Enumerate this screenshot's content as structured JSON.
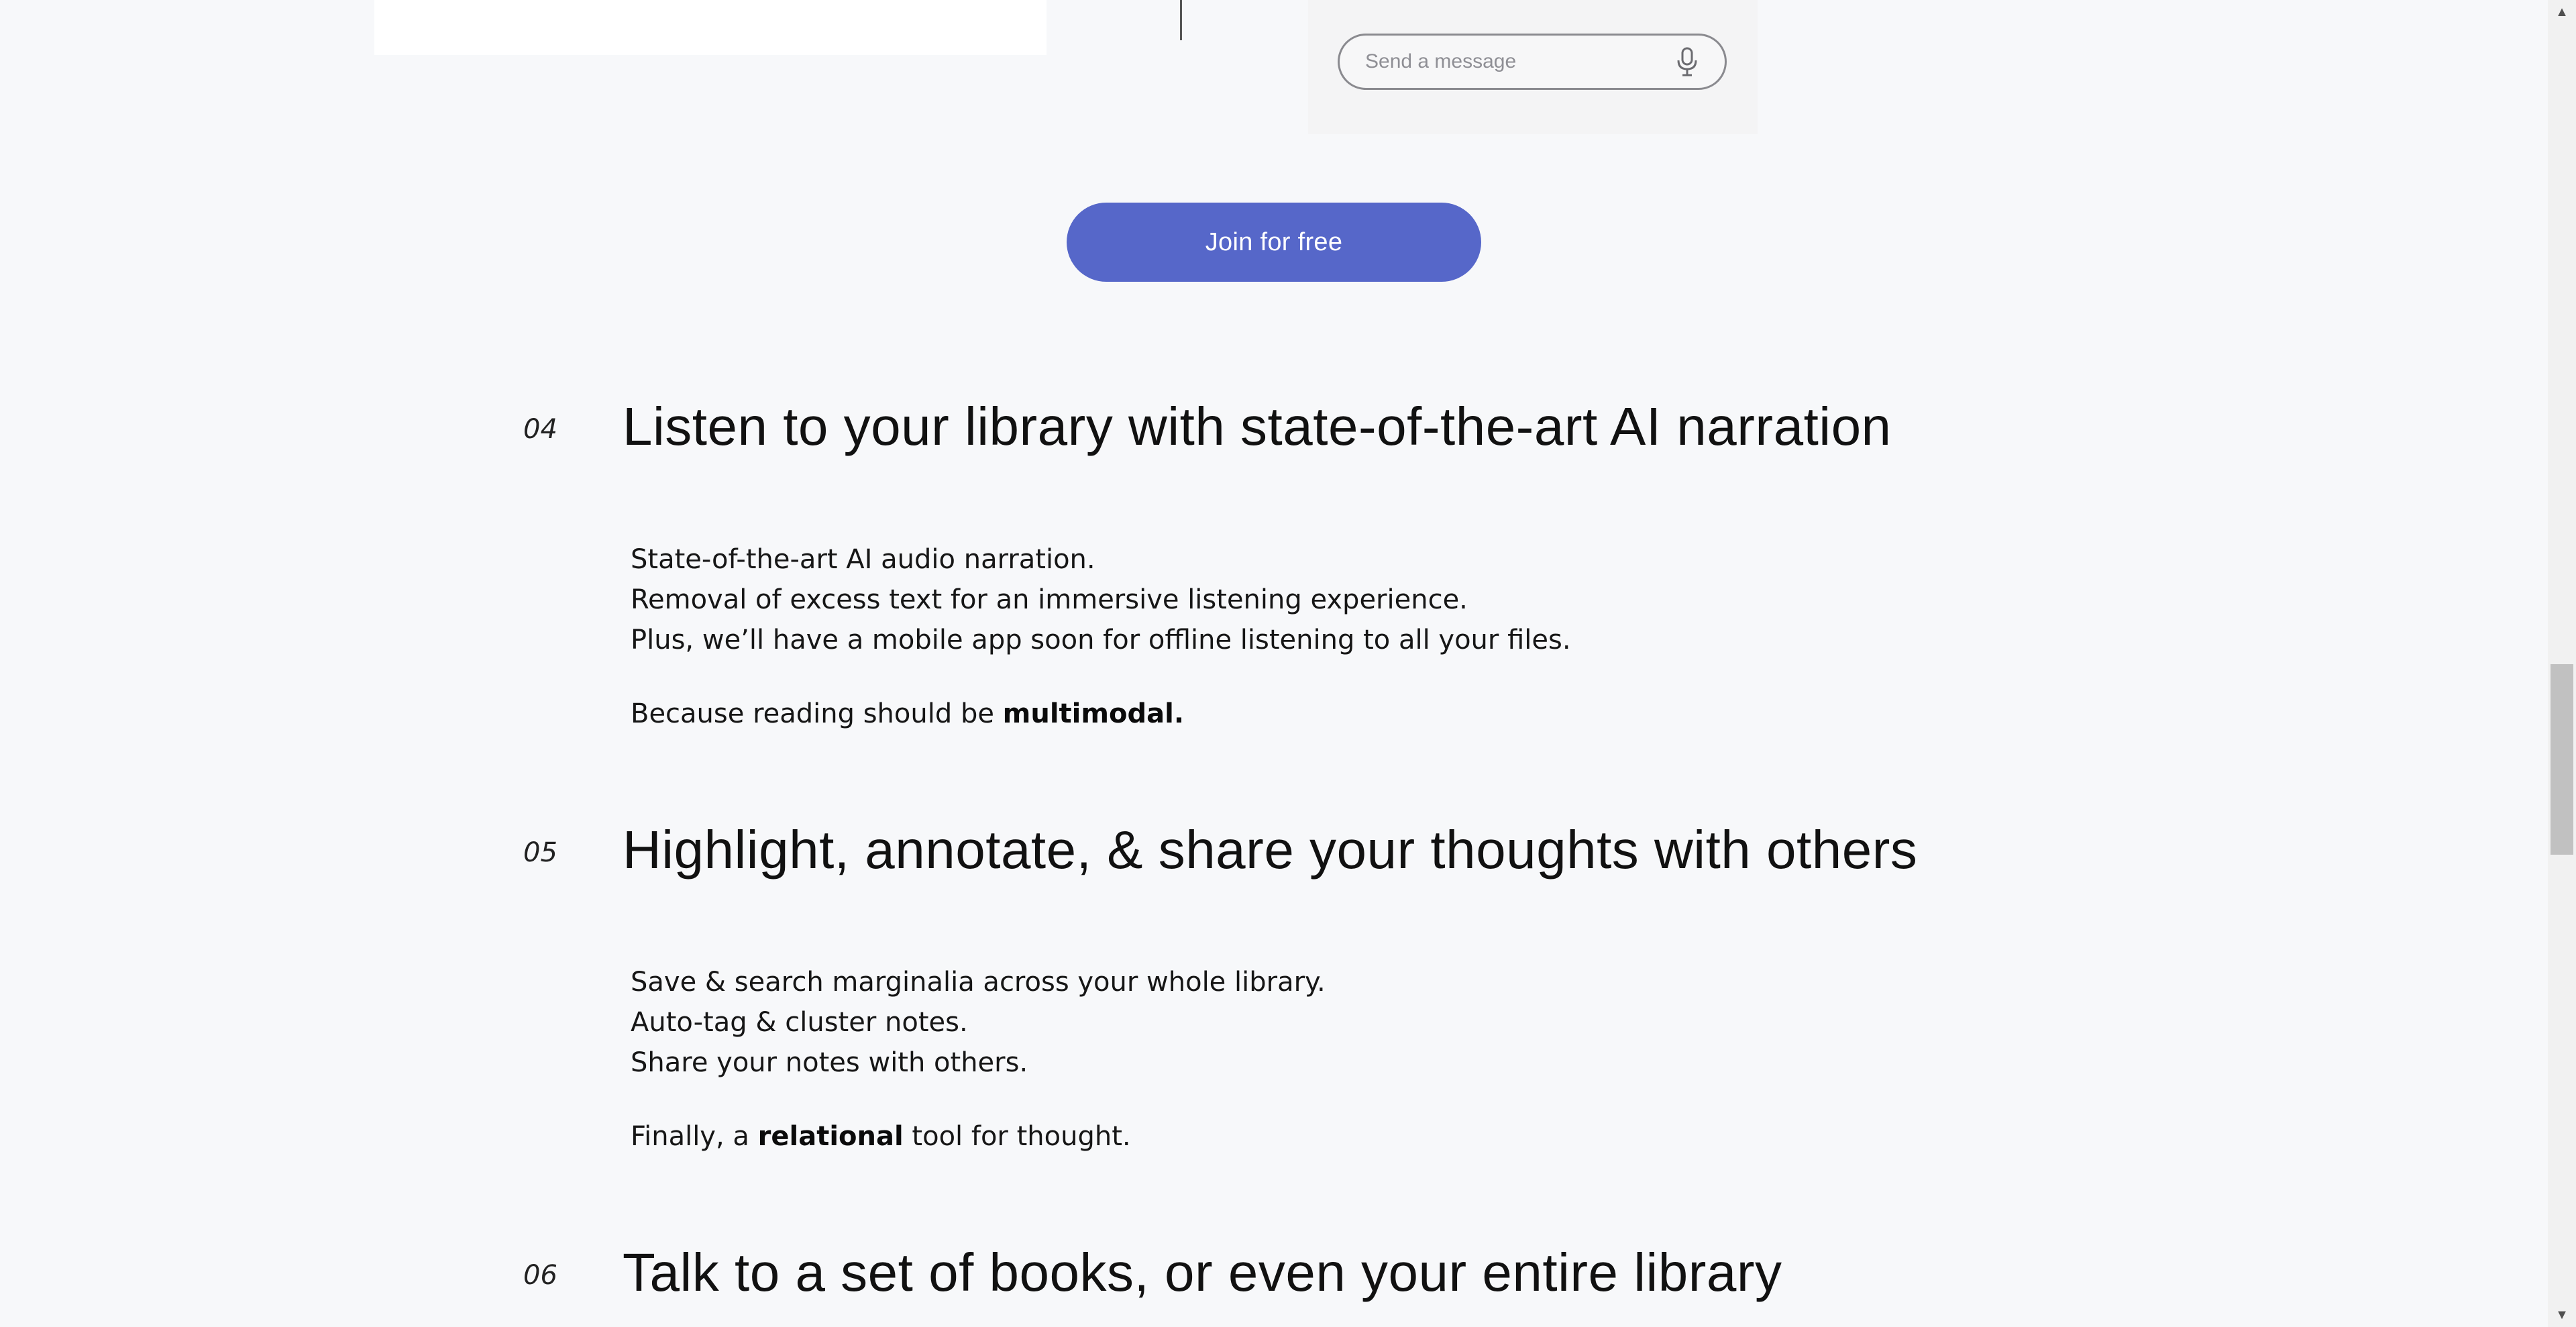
{
  "chat": {
    "placeholder": "Send a message",
    "mic_icon": "microphone-icon"
  },
  "cta": {
    "join_label": "Join for free",
    "color": "#5667c9"
  },
  "features": [
    {
      "number": "04",
      "title": "Listen to your library with state-of-the-art AI narration",
      "lines": [
        "State-of-the-art AI audio narration.",
        "Removal of excess text for an immersive listening experience.",
        "Plus, we’ll have a mobile app soon for offline listening to all your files."
      ],
      "tagline_prefix": "Because reading should be ",
      "tagline_bold": "multimodal.",
      "tagline_suffix": ""
    },
    {
      "number": "05",
      "title": "Highlight, annotate, & share your thoughts with others",
      "lines": [
        "Save & search marginalia across your whole library.",
        "Auto-tag & cluster notes.",
        "Share your notes with others."
      ],
      "tagline_prefix": "Finally, a ",
      "tagline_bold": "relational",
      "tagline_suffix": " tool for thought."
    },
    {
      "number": "06",
      "title": "Talk to a set of books, or even your entire library"
    }
  ],
  "scrollbar": {
    "up_icon": "scroll-up-arrow-icon",
    "down_icon": "scroll-down-arrow-icon",
    "up_glyph": "▲",
    "down_glyph": "▼"
  }
}
